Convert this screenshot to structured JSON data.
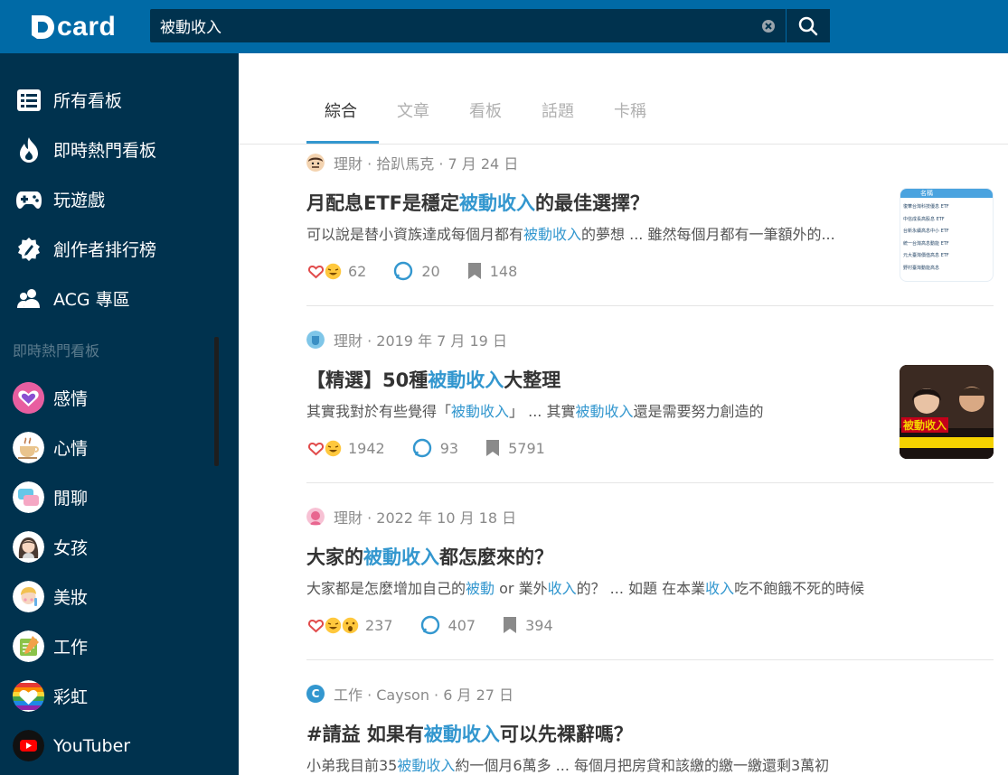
{
  "header": {
    "logo_text": "card",
    "search": {
      "value": "被動收入"
    }
  },
  "sidebar": {
    "main_items": [
      {
        "label": "所有看板",
        "icon": "list-icon"
      },
      {
        "label": "即時熱門看板",
        "icon": "flame-icon"
      },
      {
        "label": "玩遊戲",
        "icon": "gamepad-icon"
      },
      {
        "label": "創作者排行榜",
        "icon": "pen-badge-icon"
      },
      {
        "label": "ACG 專區",
        "icon": "users-icon"
      }
    ],
    "section_title": "即時熱門看板",
    "boards": [
      {
        "label": "感情",
        "icon": "heart-avatar"
      },
      {
        "label": "心情",
        "icon": "coffee-avatar"
      },
      {
        "label": "閒聊",
        "icon": "chat-bubble-avatar"
      },
      {
        "label": "女孩",
        "icon": "girl-avatar"
      },
      {
        "label": "美妝",
        "icon": "makeup-avatar"
      },
      {
        "label": "工作",
        "icon": "work-avatar"
      },
      {
        "label": "彩虹",
        "icon": "rainbow-heart-avatar"
      },
      {
        "label": "YouTuber",
        "icon": "youtube-avatar"
      }
    ]
  },
  "tabs": [
    "綜合",
    "文章",
    "看板",
    "話題",
    "卡稱"
  ],
  "posts": [
    {
      "meta": "理財 · 拾趴馬克 · 7 月 24 日",
      "title": [
        {
          "t": "月配息ETF是穩定"
        },
        {
          "t": "被動收入",
          "h": true
        },
        {
          "t": "的最佳選擇？"
        }
      ],
      "excerpt": [
        {
          "t": "可以說是替小資族達成每個月都有"
        },
        {
          "t": "被動收入",
          "h": true
        },
        {
          "t": "的夢想 ... 雖然每個月都有一筆額外的..."
        }
      ],
      "likes": "62",
      "comments": "20",
      "saves": "148",
      "thumb_rows": [
        "名稱",
        "復華台灣科技優息 ETF",
        "中信成長高股息 ETF",
        "台新永續高息中小 ETF",
        "統一台灣高息動能 ETF",
        "元大臺灣價值高息 ETF",
        "野村臺灣動能高息"
      ]
    },
    {
      "meta": "理財 · 2019 年 7 月 19 日",
      "title": [
        {
          "t": "【精選】50種"
        },
        {
          "t": "被動收入",
          "h": true
        },
        {
          "t": "大整理"
        }
      ],
      "excerpt": [
        {
          "t": "其實我對於有些覺得「"
        },
        {
          "t": "被動收入",
          "h": true
        },
        {
          "t": "」 ... 其實"
        },
        {
          "t": "被動收入",
          "h": true
        },
        {
          "t": "還是需要努力創造的"
        }
      ],
      "likes": "1942",
      "comments": "93",
      "saves": "5791",
      "thumb_caption": "被動收入"
    },
    {
      "meta": "理財 · 2022 年 10 月 18 日",
      "title": [
        {
          "t": "大家的"
        },
        {
          "t": "被動收入",
          "h": true
        },
        {
          "t": "都怎麼來的？"
        }
      ],
      "excerpt": [
        {
          "t": "大家都是怎麼增加自己的"
        },
        {
          "t": "被動",
          "h": true
        },
        {
          "t": " or 業外"
        },
        {
          "t": "收入",
          "h": true
        },
        {
          "t": "的？ ... 如題 在本業"
        },
        {
          "t": "收入",
          "h": true
        },
        {
          "t": "吃不飽餓不死的時候"
        }
      ],
      "likes": "237",
      "comments": "407",
      "saves": "394"
    },
    {
      "meta": "工作 · Cayson · 6 月 27 日",
      "avatar_letter": "C",
      "title": [
        {
          "t": "#請益 如果有"
        },
        {
          "t": "被動收入",
          "h": true
        },
        {
          "t": "可以先裸辭嗎？"
        }
      ],
      "excerpt": [
        {
          "t": "小弟我目前35"
        },
        {
          "t": "被動收入",
          "h": true
        },
        {
          "t": "約一個月6萬多 ... 每個月把房貸和該繳的繳一繳還剩3萬初"
        }
      ]
    }
  ]
}
